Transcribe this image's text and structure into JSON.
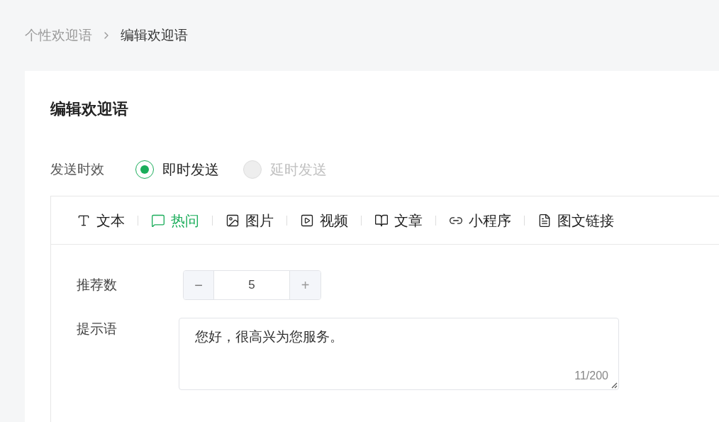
{
  "breadcrumb": [
    {
      "label": "个性欢迎语",
      "current": false
    },
    {
      "label": "编辑欢迎语",
      "current": true
    }
  ],
  "card": {
    "title": "编辑欢迎语"
  },
  "send_timing": {
    "label": "发送时效",
    "options": [
      {
        "label": "即时发送",
        "selected": true,
        "disabled": false
      },
      {
        "label": "延时发送",
        "selected": false,
        "disabled": true
      }
    ]
  },
  "editor": {
    "tabs": [
      {
        "kind": "text",
        "label": "文本",
        "selected": false
      },
      {
        "kind": "hotq",
        "label": "热问",
        "selected": true
      },
      {
        "kind": "image",
        "label": "图片",
        "selected": false
      },
      {
        "kind": "video",
        "label": "视频",
        "selected": false
      },
      {
        "kind": "article",
        "label": "文章",
        "selected": false
      },
      {
        "kind": "mini",
        "label": "小程序",
        "selected": false
      },
      {
        "kind": "link",
        "label": "图文链接",
        "selected": false
      }
    ],
    "count": {
      "label": "推荐数",
      "minus": "−",
      "value": "5",
      "plus": "+",
      "minus_disabled": false,
      "plus_disabled": true
    },
    "prompt": {
      "label": "提示语",
      "value": "您好，很高兴为您服务。",
      "counter": "11/200"
    }
  }
}
